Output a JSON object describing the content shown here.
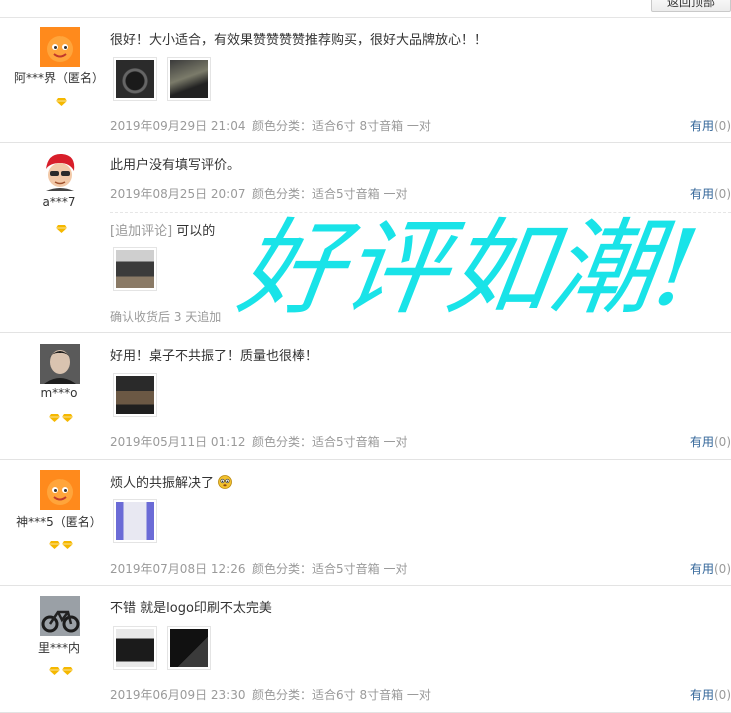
{
  "top_button": {
    "label": "返回顶部"
  },
  "overlay_text": "好评如潮!",
  "reviews": [
    {
      "user": "阿***界（匿名）",
      "levels": 1,
      "text": "很好！大小适合，有效果赞赞赞赞推荐购买，很好大品牌放心！！",
      "date": "2019年09月29日 21:04",
      "sku": "颜色分类：适合6寸 8寸音箱 一对",
      "useful_label": "有用",
      "useful_count": "(0)"
    },
    {
      "user": "a***7",
      "levels": 1,
      "text": "此用户没有填写评价。",
      "date": "2019年08月25日 20:07",
      "sku": "颜色分类：适合5寸音箱 一对",
      "useful_label": "有用",
      "useful_count": "(0)",
      "append": {
        "tag": "[追加评论]",
        "text": "可以的",
        "note": "确认收货后 3 天追加"
      }
    },
    {
      "user": "m***o",
      "levels": 2,
      "text": "好用！桌子不共振了！质量也很棒！",
      "date": "2019年05月11日 01:12",
      "sku": "颜色分类：适合5寸音箱 一对",
      "useful_label": "有用",
      "useful_count": "(0)"
    },
    {
      "user": "神***5（匿名）",
      "levels": 2,
      "text": "烦人的共振解决了",
      "date": "2019年07月08日 12:26",
      "sku": "颜色分类：适合5寸音箱 一对",
      "useful_label": "有用",
      "useful_count": "(0)"
    },
    {
      "user": "里***内",
      "levels": 2,
      "text": "不错 就是logo印刷不太完美",
      "date": "2019年06月09日 23:30",
      "sku": "颜色分类：适合6寸 8寸音箱 一对",
      "useful_label": "有用",
      "useful_count": "(0)"
    }
  ],
  "colors": {
    "link": "#336699",
    "muted": "#9a9a9a",
    "gem": "#f5b800",
    "overlay": "#19e3e8",
    "default_avatar": "#ff8a1c"
  }
}
